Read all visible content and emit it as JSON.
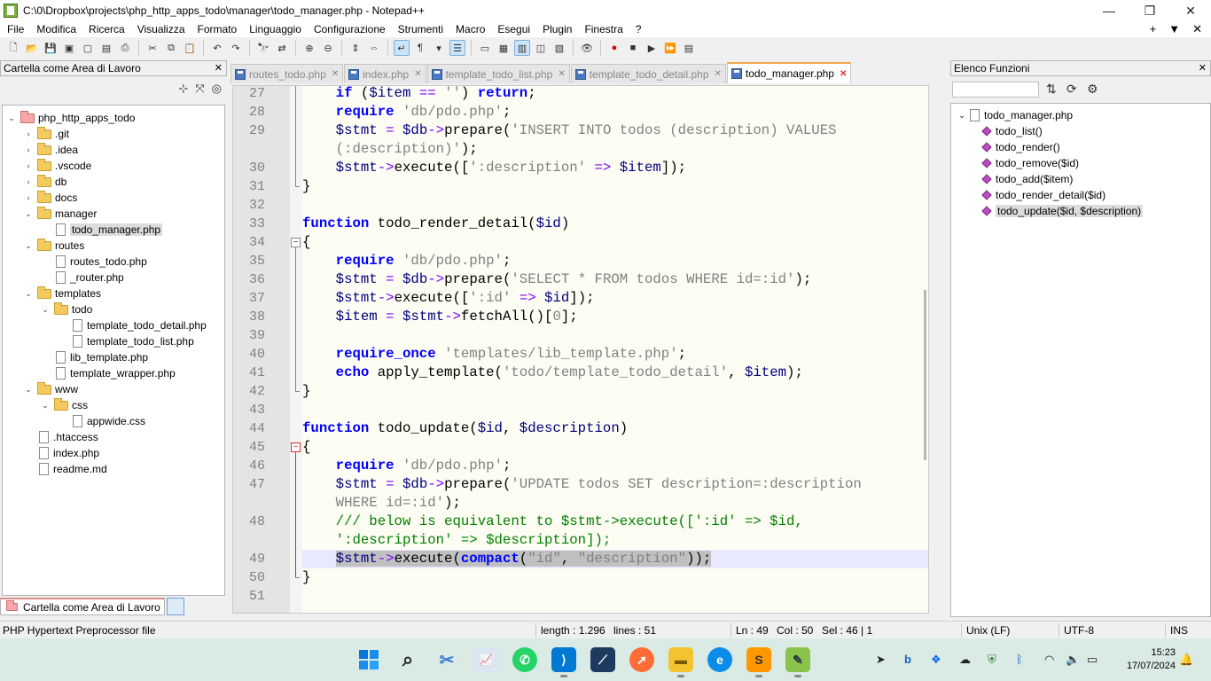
{
  "window": {
    "title": "C:\\0\\Dropbox\\projects\\php_http_apps_todo\\manager\\todo_manager.php - Notepad++",
    "minimize": "—",
    "maximize": "❐",
    "close": "✕"
  },
  "menu": {
    "items": [
      "File",
      "Modifica",
      "Ricerca",
      "Visualizza",
      "Formato",
      "Linguaggio",
      "Configurazione",
      "Strumenti",
      "Macro",
      "Esegui",
      "Plugin",
      "Finestra",
      "?"
    ],
    "right": [
      "+",
      "▼",
      "✕"
    ]
  },
  "left_panel": {
    "title": "Cartella come Area di Lavoro",
    "close": "✕",
    "bottom_tab": "Cartella come Area di Lavoro",
    "tree": [
      {
        "label": "php_http_apps_todo",
        "type": "project",
        "level": 0,
        "expanded": true
      },
      {
        "label": ".git",
        "type": "folder",
        "level": 1,
        "expanded": false
      },
      {
        "label": ".idea",
        "type": "folder",
        "level": 1,
        "expanded": false
      },
      {
        "label": ".vscode",
        "type": "folder",
        "level": 1,
        "expanded": false
      },
      {
        "label": "db",
        "type": "folder",
        "level": 1,
        "expanded": false
      },
      {
        "label": "docs",
        "type": "folder",
        "level": 1,
        "expanded": false
      },
      {
        "label": "manager",
        "type": "folder",
        "level": 1,
        "expanded": true
      },
      {
        "label": "todo_manager.php",
        "type": "file",
        "level": 2,
        "selected": true
      },
      {
        "label": "routes",
        "type": "folder",
        "level": 1,
        "expanded": true
      },
      {
        "label": "routes_todo.php",
        "type": "file",
        "level": 2
      },
      {
        "label": "_router.php",
        "type": "file",
        "level": 2
      },
      {
        "label": "templates",
        "type": "folder",
        "level": 1,
        "expanded": true
      },
      {
        "label": "todo",
        "type": "folder",
        "level": 2,
        "expanded": true
      },
      {
        "label": "template_todo_detail.php",
        "type": "file",
        "level": 3
      },
      {
        "label": "template_todo_list.php",
        "type": "file",
        "level": 3
      },
      {
        "label": "lib_template.php",
        "type": "file",
        "level": 2
      },
      {
        "label": "template_wrapper.php",
        "type": "file",
        "level": 2
      },
      {
        "label": "www",
        "type": "folder",
        "level": 1,
        "expanded": true
      },
      {
        "label": "css",
        "type": "folder",
        "level": 2,
        "expanded": true
      },
      {
        "label": "appwide.css",
        "type": "file",
        "level": 3
      },
      {
        "label": ".htaccess",
        "type": "file",
        "level": 1
      },
      {
        "label": "index.php",
        "type": "file",
        "level": 1
      },
      {
        "label": "readme.md",
        "type": "file",
        "level": 1
      }
    ]
  },
  "tabs": [
    {
      "label": "routes_todo.php",
      "active": false
    },
    {
      "label": "index.php",
      "active": false
    },
    {
      "label": "template_todo_list.php",
      "active": false
    },
    {
      "label": "template_todo_detail.php",
      "active": false
    },
    {
      "label": "todo_manager.php",
      "active": true
    }
  ],
  "code_lines": [
    {
      "n": "27",
      "html": "    <span class=\"kw\">if</span> (<span class=\"var\">$item</span> <span class=\"op\">==</span> <span class=\"str\">''</span>) <span class=\"kw\">return</span>;"
    },
    {
      "n": "28",
      "html": "    <span class=\"kw\">require</span> <span class=\"str\">'db/pdo.php'</span>;"
    },
    {
      "n": "29",
      "html": "    <span class=\"var\">$stmt</span> <span class=\"op\">=</span> <span class=\"var\">$db</span><span class=\"op\">-&gt;</span>prepare(<span class=\"str\">'INSERT INTO todos (description) VALUES</span>"
    },
    {
      "n": "",
      "html": "    <span class=\"str\">(:description)'</span>);"
    },
    {
      "n": "30",
      "html": "    <span class=\"var\">$stmt</span><span class=\"op\">-&gt;</span>execute([<span class=\"str\">':description'</span> <span class=\"op\">=&gt;</span> <span class=\"var\">$item</span>]);"
    },
    {
      "n": "31",
      "html": "}"
    },
    {
      "n": "32",
      "html": ""
    },
    {
      "n": "33",
      "html": "<span class=\"kw\">function</span> todo_render_detail(<span class=\"var\">$id</span>)"
    },
    {
      "n": "34",
      "html": "{"
    },
    {
      "n": "35",
      "html": "    <span class=\"kw\">require</span> <span class=\"str\">'db/pdo.php'</span>;"
    },
    {
      "n": "36",
      "html": "    <span class=\"var\">$stmt</span> <span class=\"op\">=</span> <span class=\"var\">$db</span><span class=\"op\">-&gt;</span>prepare(<span class=\"str\">'SELECT * FROM todos WHERE id=:id'</span>);"
    },
    {
      "n": "37",
      "html": "    <span class=\"var\">$stmt</span><span class=\"op\">-&gt;</span>execute([<span class=\"str\">':id'</span> <span class=\"op\">=&gt;</span> <span class=\"var\">$id</span>]);"
    },
    {
      "n": "38",
      "html": "    <span class=\"var\">$item</span> <span class=\"op\">=</span> <span class=\"var\">$stmt</span><span class=\"op\">-&gt;</span>fetchAll()[<span class=\"str\">0</span>];"
    },
    {
      "n": "39",
      "html": ""
    },
    {
      "n": "40",
      "html": "    <span class=\"kw\">require_once</span> <span class=\"str\">'templates/lib_template.php'</span>;"
    },
    {
      "n": "41",
      "html": "    <span class=\"kw\">echo</span> apply_template(<span class=\"str\">'todo/template_todo_detail'</span>, <span class=\"var\">$item</span>);"
    },
    {
      "n": "42",
      "html": "}"
    },
    {
      "n": "43",
      "html": ""
    },
    {
      "n": "44",
      "html": "<span class=\"kw\">function</span> todo_update(<span class=\"var\">$id</span>, <span class=\"var\">$description</span>)"
    },
    {
      "n": "45",
      "html": "{"
    },
    {
      "n": "46",
      "html": "    <span class=\"kw\">require</span> <span class=\"str\">'db/pdo.php'</span>;"
    },
    {
      "n": "47",
      "html": "    <span class=\"var\">$stmt</span> <span class=\"op\">=</span> <span class=\"var\">$db</span><span class=\"op\">-&gt;</span>prepare(<span class=\"str\">'UPDATE todos SET description=:description</span>"
    },
    {
      "n": "",
      "html": "    <span class=\"str\">WHERE id=:id'</span>);"
    },
    {
      "n": "48",
      "html": "    <span class=\"cmt\">/// below is equivalent to $stmt-&gt;execute([':id' =&gt; $id,</span>"
    },
    {
      "n": "",
      "html": "    <span class=\"cmt\">':description' =&gt; $description]);</span>"
    },
    {
      "n": "49",
      "html": "    <span class=\"sel\"><span class=\"var\">$stmt</span><span class=\"op\">-&gt;</span>execute(<span class=\"kw\">compact</span>(<span class=\"str\">\"id\"</span>, <span class=\"str\">\"description\"</span>));</span>",
      "current": true
    },
    {
      "n": "50",
      "html": "}"
    },
    {
      "n": "51",
      "html": ""
    }
  ],
  "right_panel": {
    "title": "Elenco Funzioni",
    "close": "✕",
    "file": "todo_manager.php",
    "functions": [
      {
        "label": "todo_list()",
        "selected": false
      },
      {
        "label": "todo_render()",
        "selected": false
      },
      {
        "label": "todo_remove($id)",
        "selected": false
      },
      {
        "label": "todo_add($item)",
        "selected": false
      },
      {
        "label": "todo_render_detail($id)",
        "selected": false
      },
      {
        "label": "todo_update($id, $description)",
        "selected": true
      }
    ]
  },
  "status": {
    "file_type": "PHP Hypertext Preprocessor file",
    "length": "length : 1.296",
    "lines": "lines : 51",
    "ln": "Ln : 49",
    "col": "Col : 50",
    "sel": "Sel : 46 | 1",
    "eol": "Unix (LF)",
    "encoding": "UTF-8",
    "mode": "INS"
  },
  "taskbar": {
    "time": "15:23",
    "date": "17/07/2024"
  },
  "colors": {
    "keyword": "#0000ff",
    "string": "#808080",
    "comment": "#008000",
    "operator": "#8000ff",
    "editor_bg": "#fefdf4",
    "current_line": "#e8e8ff",
    "taskbar_bg": "#daeae4"
  }
}
